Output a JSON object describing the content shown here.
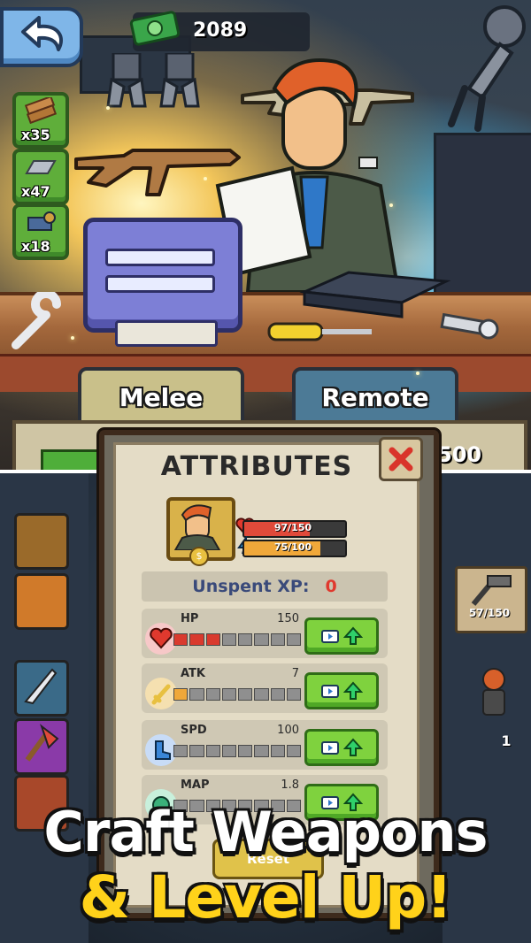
{
  "currency": {
    "amount": "2089",
    "icon": "cash-icon"
  },
  "resources": [
    {
      "name": "wood",
      "count": "x35",
      "icon": "wood-plank-icon"
    },
    {
      "name": "metal",
      "count": "x47",
      "icon": "metal-ingot-icon"
    },
    {
      "name": "parts",
      "count": "x18",
      "icon": "parts-icon"
    }
  ],
  "tabs": [
    {
      "label": "Melee",
      "color": "#c9c08a"
    },
    {
      "label": "Remote",
      "color": "#4c7a96"
    }
  ],
  "partial_value": "500",
  "dialog": {
    "title": "ATTRIBUTES",
    "hp_bar": {
      "text": "97/150",
      "fraction": 0.647,
      "color": "#e04a3a"
    },
    "energy_bar": {
      "text": "75/100",
      "fraction": 0.75,
      "color": "#f0a83a"
    },
    "xp_label": "Unspent XP:",
    "xp_value": "0",
    "attributes": [
      {
        "name": "HP",
        "value": "150",
        "filled_segments": 3,
        "total_segments": 8,
        "fill_color": "#d93a2e",
        "icon": "heart-icon"
      },
      {
        "name": "ATK",
        "value": "7",
        "filled_segments": 1,
        "total_segments": 8,
        "fill_color": "#f0a83a",
        "icon": "sword-icon"
      },
      {
        "name": "SPD",
        "value": "100",
        "filled_segments": 0,
        "total_segments": 8,
        "fill_color": "#4a8ed8",
        "icon": "boot-icon"
      },
      {
        "name": "MAP",
        "value": "1.8",
        "filled_segments": 0,
        "total_segments": 8,
        "fill_color": "#3ab07a",
        "icon": "map-icon"
      }
    ],
    "reset_label": "Reset"
  },
  "side_card": {
    "progress_text": "57/150"
  },
  "side_count": "1",
  "promo": {
    "line1": "Craft Weapons",
    "line2": "& Level Up!"
  }
}
